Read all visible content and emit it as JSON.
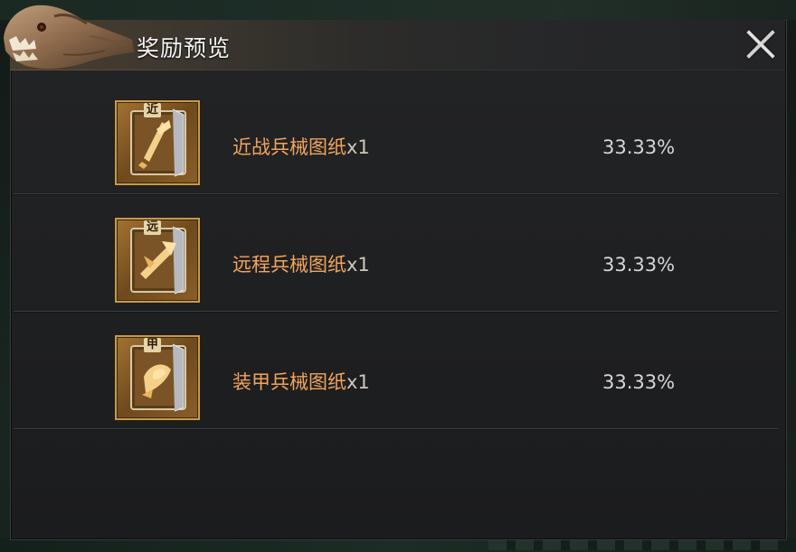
{
  "window": {
    "title": "奖励预览"
  },
  "rewards": [
    {
      "tag": "近",
      "name": "近战兵械图纸",
      "qty": "x1",
      "chance": "33.33%"
    },
    {
      "tag": "远",
      "name": "远程兵械图纸",
      "qty": "x1",
      "chance": "33.33%"
    },
    {
      "tag": "甲",
      "name": "装甲兵械图纸",
      "qty": "x1",
      "chance": "33.33%"
    }
  ],
  "colors": {
    "item_name": "#f2a45c",
    "quantity": "#cfc6b8",
    "chance": "#d6d6d6",
    "icon_border": "#c49a4f"
  },
  "icons": {
    "close": "close-x-icon",
    "header_art": "dinosaur-skull-icon",
    "item": "blueprint-scroll-icon"
  }
}
